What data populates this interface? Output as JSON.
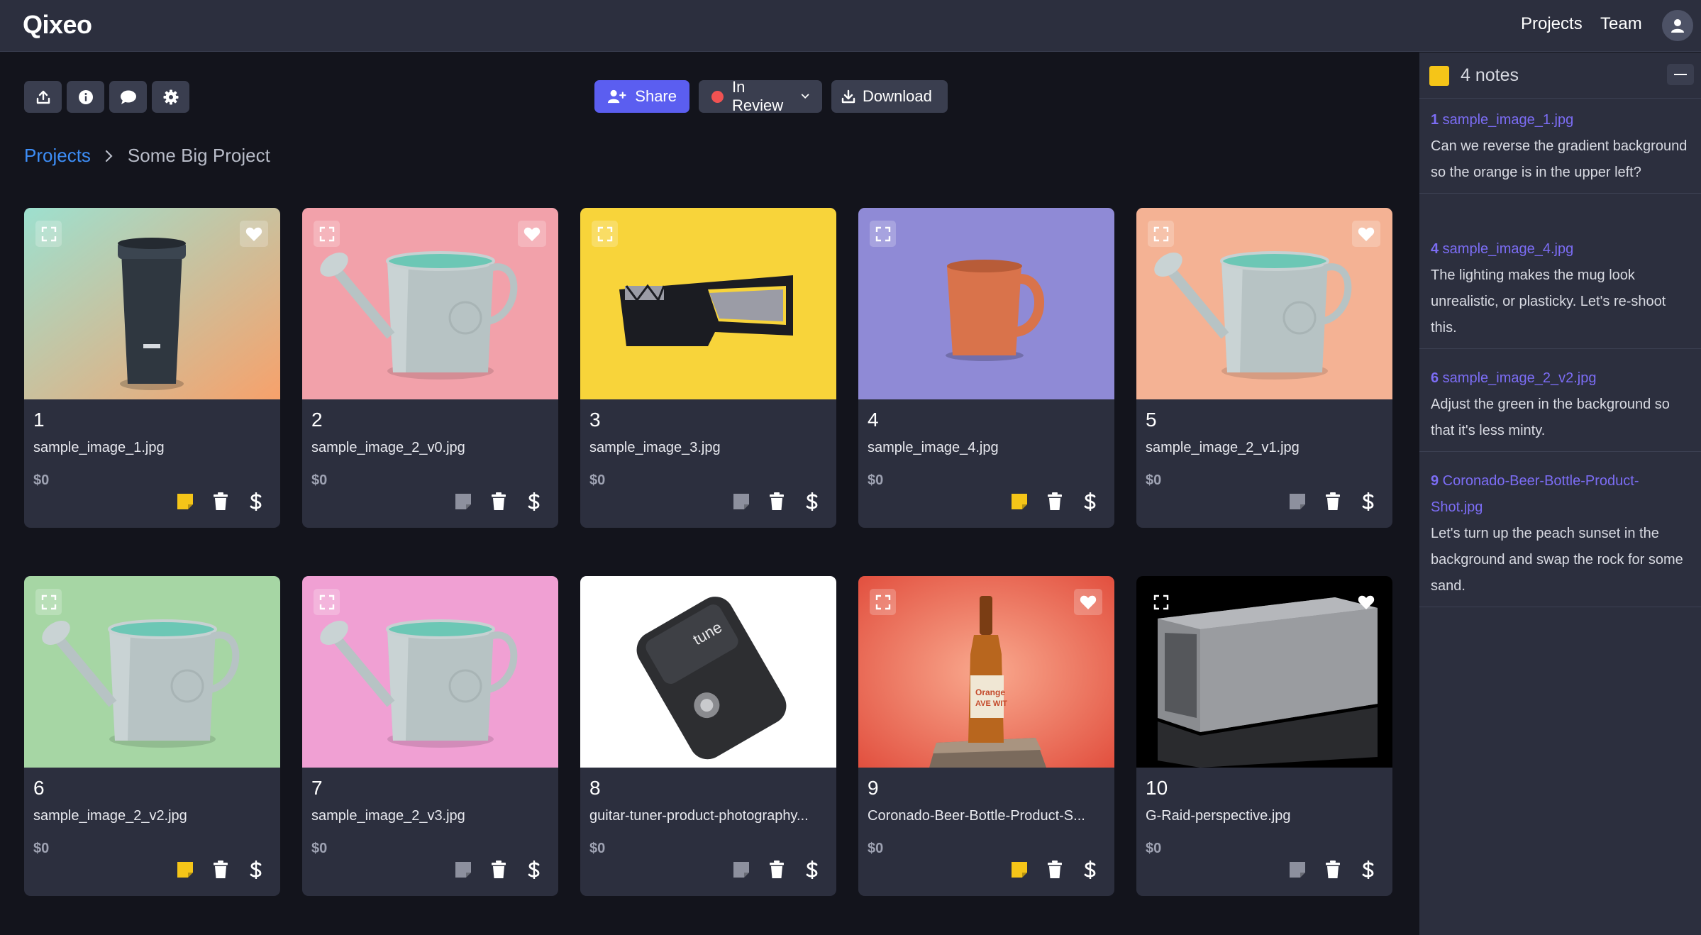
{
  "app": {
    "logo": "Qixeo",
    "nav": {
      "projects": "Projects",
      "team": "Team"
    }
  },
  "toolbar": {
    "share": "Share",
    "status": "In Review",
    "download": "Download"
  },
  "breadcrumb": {
    "root": "Projects",
    "current": "Some Big Project"
  },
  "cards": [
    {
      "num": "1",
      "name": "sample_image_1.jpg",
      "price": "$0",
      "has_note": true
    },
    {
      "num": "2",
      "name": "sample_image_2_v0.jpg",
      "price": "$0",
      "has_note": false
    },
    {
      "num": "3",
      "name": "sample_image_3.jpg",
      "price": "$0",
      "has_note": false
    },
    {
      "num": "4",
      "name": "sample_image_4.jpg",
      "price": "$0",
      "has_note": true
    },
    {
      "num": "5",
      "name": "sample_image_2_v1.jpg",
      "price": "$0",
      "has_note": false
    },
    {
      "num": "6",
      "name": "sample_image_2_v2.jpg",
      "price": "$0",
      "has_note": true
    },
    {
      "num": "7",
      "name": "sample_image_2_v3.jpg",
      "price": "$0",
      "has_note": false
    },
    {
      "num": "8",
      "name": "guitar-tuner-product-photography...",
      "price": "$0",
      "has_note": false
    },
    {
      "num": "9",
      "name": "Coronado-Beer-Bottle-Product-S...",
      "price": "$0",
      "has_note": true
    },
    {
      "num": "10",
      "name": "G-Raid-perspective.jpg",
      "price": "$0",
      "has_note": false
    }
  ],
  "notes": {
    "title": "4 notes",
    "items": [
      {
        "num": "1",
        "file": "sample_image_1.jpg",
        "text": "Can we reverse the gradient background so the orange is in the upper left?"
      },
      {
        "num": "4",
        "file": "sample_image_4.jpg",
        "text": "The lighting makes the mug look unrealistic, or plasticky. Let's re-shoot this."
      },
      {
        "num": "6",
        "file": "sample_image_2_v2.jpg",
        "text": "Adjust the green in the background so that it's less minty."
      },
      {
        "num": "9",
        "file": "Coronado-Beer-Bottle-Product-Shot.jpg",
        "text": "Let's turn up the peach sunset in the background and swap the rock for some sand."
      }
    ]
  },
  "colors": {
    "accent": "#5b5ef0",
    "link": "#3d8ef8",
    "note_link": "#7c6df5",
    "note_yellow": "#f5c518",
    "status_red": "#f05252"
  }
}
